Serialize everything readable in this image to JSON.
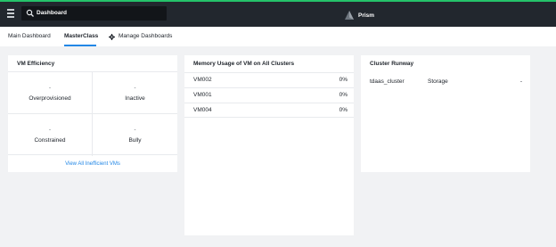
{
  "header": {
    "search_value": "Dashboard",
    "brand": "Prism",
    "accent_color": "#25c26a"
  },
  "subnav": {
    "tabs": [
      "Main Dashboard",
      "MasterClass"
    ],
    "active_tab": "MasterClass",
    "manage_label": "Manage Dashboards"
  },
  "vm_efficiency": {
    "title": "VM Efficiency",
    "cells": [
      {
        "value": "-",
        "label": "Overprovisioned"
      },
      {
        "value": "-",
        "label": "Inactive"
      },
      {
        "value": "-",
        "label": "Constrained"
      },
      {
        "value": "-",
        "label": "Bully"
      }
    ],
    "link": "View All Inefficient VMs"
  },
  "memory_usage": {
    "title": "Memory Usage of VM on All Clusters",
    "rows": [
      {
        "name": "VM002",
        "value": "0%"
      },
      {
        "name": "VM001",
        "value": "0%"
      },
      {
        "name": "VM004",
        "value": "0%"
      }
    ]
  },
  "cluster_runway": {
    "title": "Cluster Runway",
    "rows": [
      {
        "cluster": "tdaas_cluster",
        "resource": "Storage",
        "value": "-"
      }
    ]
  }
}
